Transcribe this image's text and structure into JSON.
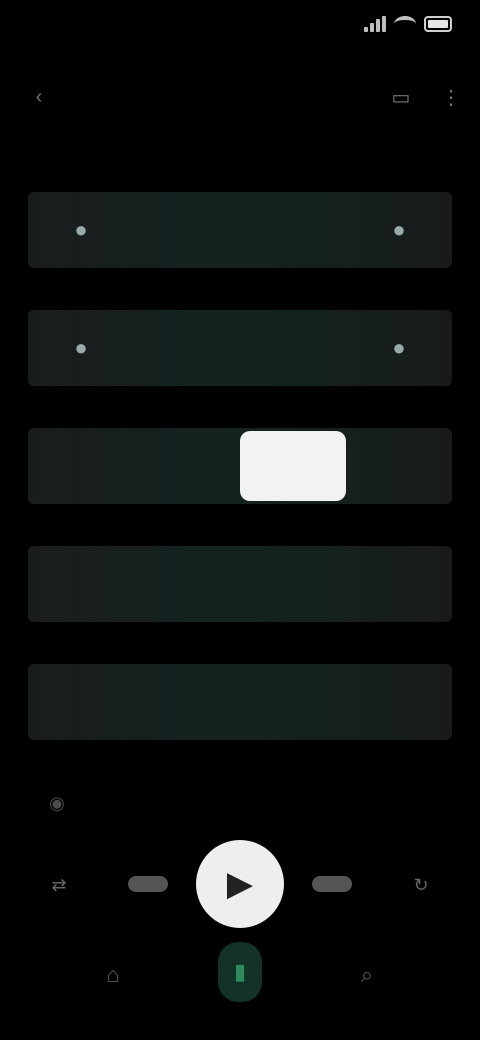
{
  "status_bar": {
    "time": "",
    "icons": [
      "signal-icon",
      "wifi-icon",
      "battery-icon"
    ]
  },
  "header": {
    "title": "",
    "icons": [
      "back-icon",
      "cast-icon",
      "more-icon"
    ]
  },
  "grid": {
    "rows": [
      {
        "cells": [
          "",
          "",
          "",
          ""
        ]
      },
      {
        "cells": [
          "",
          "",
          "",
          ""
        ]
      },
      {
        "cells": [
          "",
          "",
          "",
          ""
        ]
      },
      {
        "cells": [
          "",
          "",
          "",
          ""
        ]
      },
      {
        "cells": [
          "",
          "",
          "",
          ""
        ]
      }
    ],
    "selected": {
      "row": 2,
      "col": 2
    }
  },
  "player": {
    "icons": [
      "shuffle-icon",
      "previous-icon",
      "play-icon",
      "next-icon",
      "repeat-icon"
    ]
  },
  "nav": {
    "items": [
      "home-icon",
      "library-icon",
      "search-icon"
    ],
    "active_index": 1
  },
  "colors": {
    "background": "#000000",
    "selected_tile": "#f2f2f2",
    "accent_green": "#2d8a5e"
  }
}
